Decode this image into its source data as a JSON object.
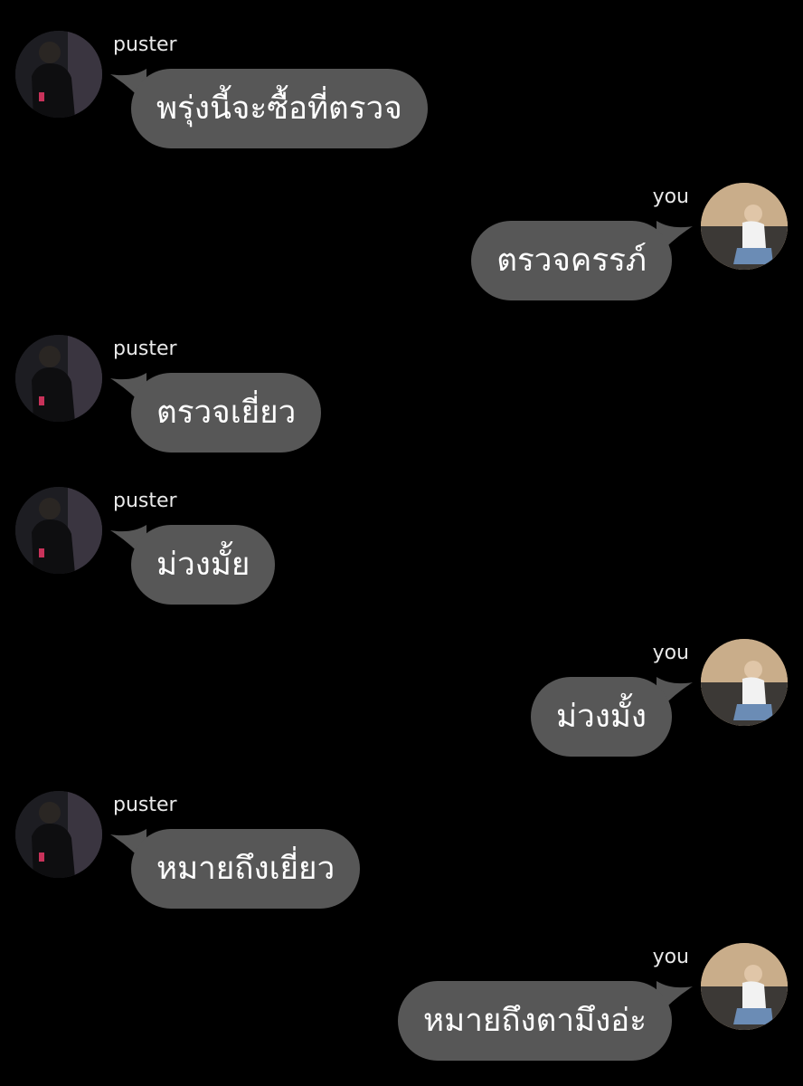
{
  "colors": {
    "background": "#000000",
    "bubble": "#575757",
    "text": "#ffffff",
    "sender": "#e9e9e9"
  },
  "messages": [
    {
      "sender": "puster",
      "side": "left",
      "text": "พรุ่งนี้จะซื้อที่ตรวจ",
      "avatar": "avatar-puster"
    },
    {
      "sender": "you",
      "side": "right",
      "text": "ตรวจครรภ์",
      "avatar": "avatar-you"
    },
    {
      "sender": "puster",
      "side": "left",
      "text": "ตรวจเยี่ยว",
      "avatar": "avatar-puster"
    },
    {
      "sender": "puster",
      "side": "left",
      "text": "ม่วงมั้ย",
      "avatar": "avatar-puster"
    },
    {
      "sender": "you",
      "side": "right",
      "text": "ม่วงมั้ง",
      "avatar": "avatar-you"
    },
    {
      "sender": "puster",
      "side": "left",
      "text": "หมายถึงเยี่ยว",
      "avatar": "avatar-puster"
    },
    {
      "sender": "you",
      "side": "right",
      "text": "หมายถึงตามึงอ่ะ",
      "avatar": "avatar-you"
    }
  ]
}
